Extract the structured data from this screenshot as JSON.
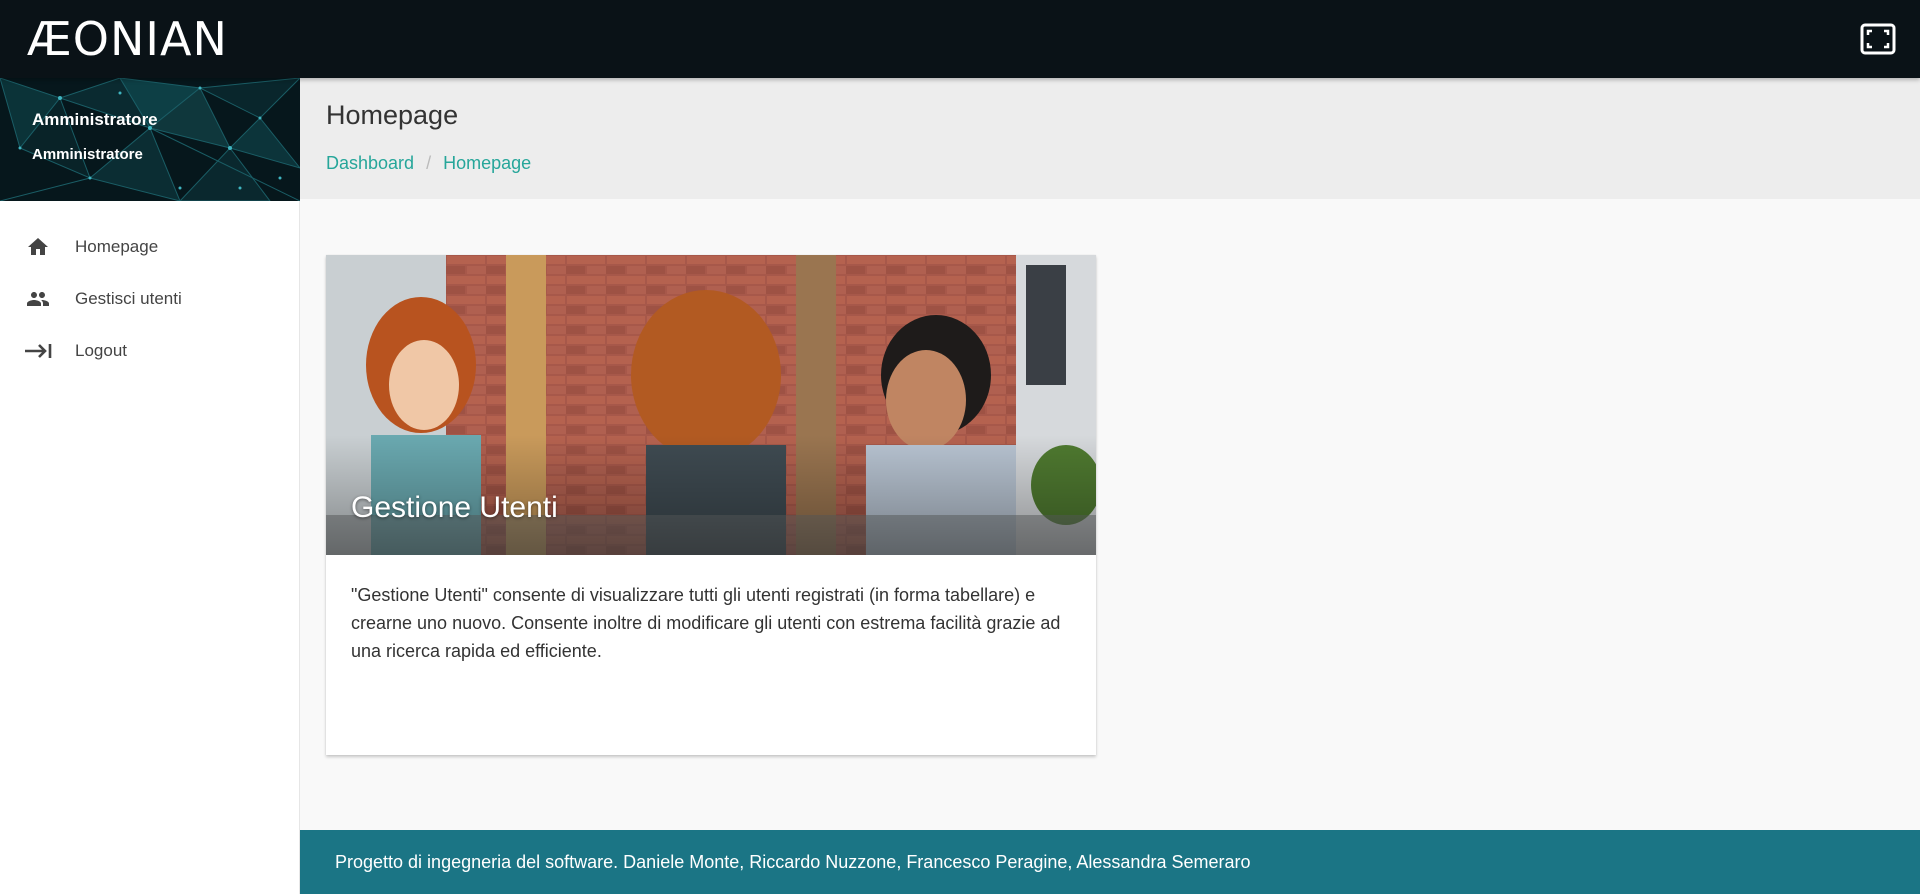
{
  "header": {
    "logo": "ÆONIAN",
    "fullscreen_icon": "fullscreen-icon"
  },
  "sidebar": {
    "user_name": "Amministratore",
    "user_role": "Amministratore",
    "items": [
      {
        "label": "Homepage",
        "icon": "home-icon"
      },
      {
        "label": "Gestisci utenti",
        "icon": "users-icon"
      },
      {
        "label": "Logout",
        "icon": "logout-icon"
      }
    ]
  },
  "main": {
    "title": "Homepage",
    "breadcrumb": [
      "Dashboard",
      "Homepage"
    ],
    "card": {
      "title": "Gestione Utenti",
      "description": "\"Gestione Utenti\" consente di visualizzare tutti gli utenti registrati (in forma tabellare) e crearne uno nuovo. Consente inoltre di modificare gli utenti con estrema facilità grazie ad una ricerca rapida ed efficiente."
    }
  },
  "footer": {
    "text": "Progetto di ingegneria del software. Daniele Monte, Riccardo Nuzzone, Francesco Peragine, Alessandra Semeraro"
  },
  "colors": {
    "topbar": "#0a1217",
    "accent": "#26a69a",
    "footer": "#1b7585"
  }
}
